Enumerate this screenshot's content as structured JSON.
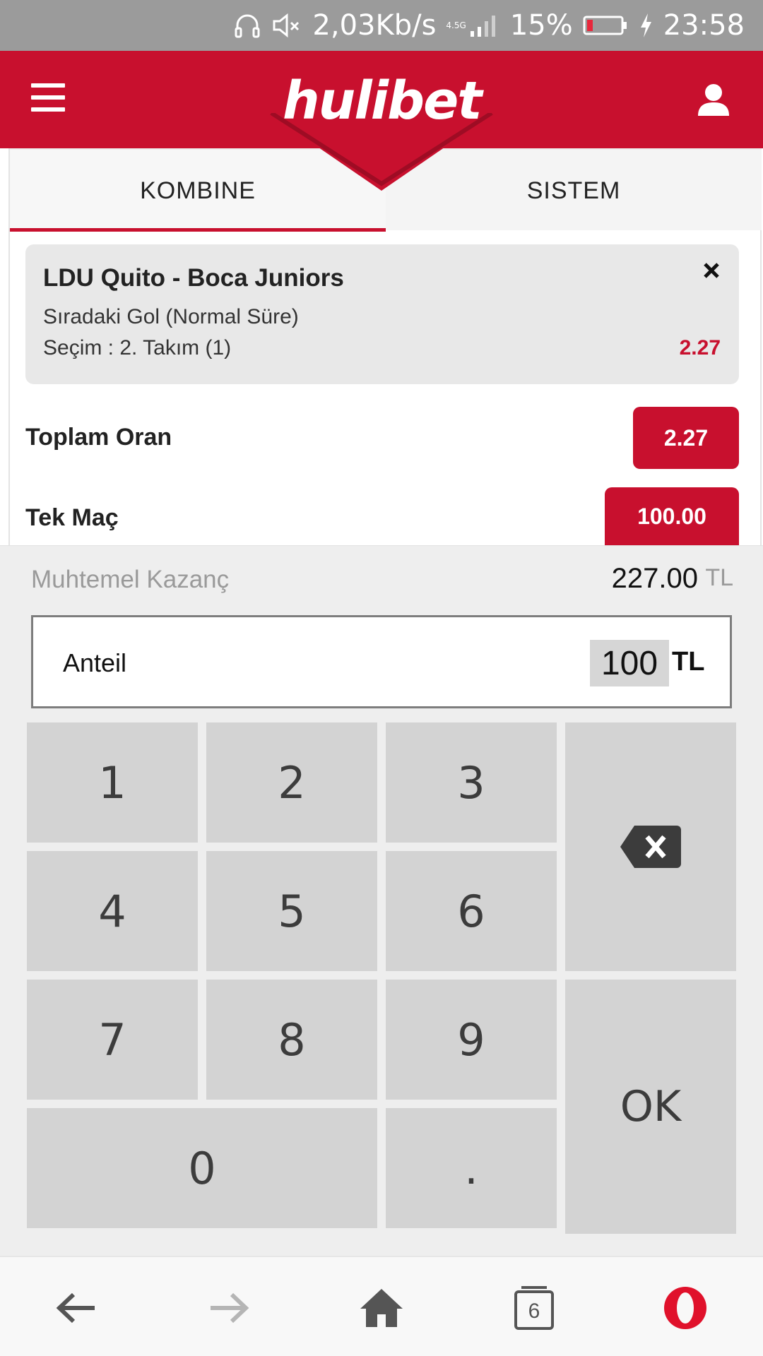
{
  "status_bar": {
    "network_speed": "2,03Kb/s",
    "network_type": "4.5G",
    "battery_percent": "15%",
    "time": "23:58"
  },
  "header": {
    "logo_text": "hulibet",
    "menu_icon": "hamburger-menu-icon",
    "user_icon": "user-icon",
    "brand_color": "#c8102e"
  },
  "tabs": [
    {
      "label": "KOMBINE",
      "active": true
    },
    {
      "label": "SISTEM",
      "active": false
    }
  ],
  "bet": {
    "match": "LDU Quito - Boca Juniors",
    "market": "Sıradaki Gol (Normal Süre)",
    "selection": "Seçim : 2. Takım (1)",
    "odd": "2.27"
  },
  "summary": {
    "total_odds_label": "Toplam Oran",
    "total_odds_value": "2.27",
    "single_label": "Tek Maç",
    "single_value": "100.00"
  },
  "potential_win": {
    "label": "Muhtemel Kazanç",
    "value": "227.00",
    "currency": "TL"
  },
  "stake": {
    "label": "Anteil",
    "value": "100",
    "currency": "TL"
  },
  "keypad": {
    "k1": "1",
    "k2": "2",
    "k3": "3",
    "k4": "4",
    "k5": "5",
    "k6": "6",
    "k7": "7",
    "k8": "8",
    "k9": "9",
    "k0": "0",
    "dot": ".",
    "ok": "OK",
    "backspace_icon": "backspace-icon"
  },
  "browser_bar": {
    "open_tabs": "6",
    "icons": [
      "back-arrow-icon",
      "forward-arrow-icon",
      "home-icon",
      "tabs-icon",
      "opera-icon"
    ]
  }
}
